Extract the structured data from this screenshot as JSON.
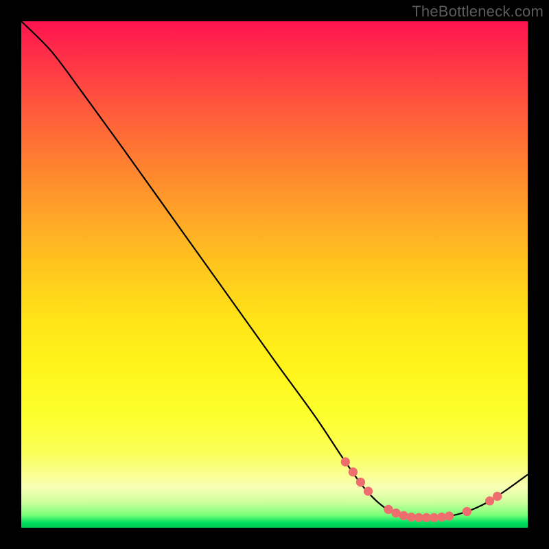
{
  "watermark": "TheBottleneck.com",
  "colors": {
    "dot": "#ee6e6e",
    "line": "#000000",
    "background_top": "#ff1450",
    "background_bottom": "#00c850",
    "page_margin": "#000000"
  },
  "chart_data": {
    "type": "line",
    "title": "",
    "xlabel": "",
    "ylabel": "",
    "xlim": [
      0,
      100
    ],
    "ylim": [
      0,
      100
    ],
    "curve": [
      {
        "x": 0,
        "y": 100
      },
      {
        "x": 6,
        "y": 94
      },
      {
        "x": 12,
        "y": 86
      },
      {
        "x": 20,
        "y": 75
      },
      {
        "x": 30,
        "y": 61
      },
      {
        "x": 40,
        "y": 47
      },
      {
        "x": 50,
        "y": 33
      },
      {
        "x": 58,
        "y": 22
      },
      {
        "x": 64,
        "y": 13
      },
      {
        "x": 68,
        "y": 7.5
      },
      {
        "x": 72,
        "y": 3.8
      },
      {
        "x": 76,
        "y": 2.2
      },
      {
        "x": 80,
        "y": 2.0
      },
      {
        "x": 84,
        "y": 2.2
      },
      {
        "x": 88,
        "y": 3.2
      },
      {
        "x": 92,
        "y": 5.0
      },
      {
        "x": 96,
        "y": 7.6
      },
      {
        "x": 100,
        "y": 10.5
      }
    ],
    "points": [
      {
        "x": 64.0,
        "y": 13.0
      },
      {
        "x": 65.5,
        "y": 11.0
      },
      {
        "x": 67.0,
        "y": 9.0
      },
      {
        "x": 68.5,
        "y": 7.2
      },
      {
        "x": 72.5,
        "y": 3.6
      },
      {
        "x": 74.0,
        "y": 2.9
      },
      {
        "x": 75.5,
        "y": 2.4
      },
      {
        "x": 77.0,
        "y": 2.1
      },
      {
        "x": 78.5,
        "y": 2.0
      },
      {
        "x": 80.0,
        "y": 2.0
      },
      {
        "x": 81.5,
        "y": 2.0
      },
      {
        "x": 83.0,
        "y": 2.1
      },
      {
        "x": 84.5,
        "y": 2.3
      },
      {
        "x": 88.0,
        "y": 3.2
      },
      {
        "x": 92.5,
        "y": 5.3
      },
      {
        "x": 94.0,
        "y": 6.2
      }
    ]
  }
}
